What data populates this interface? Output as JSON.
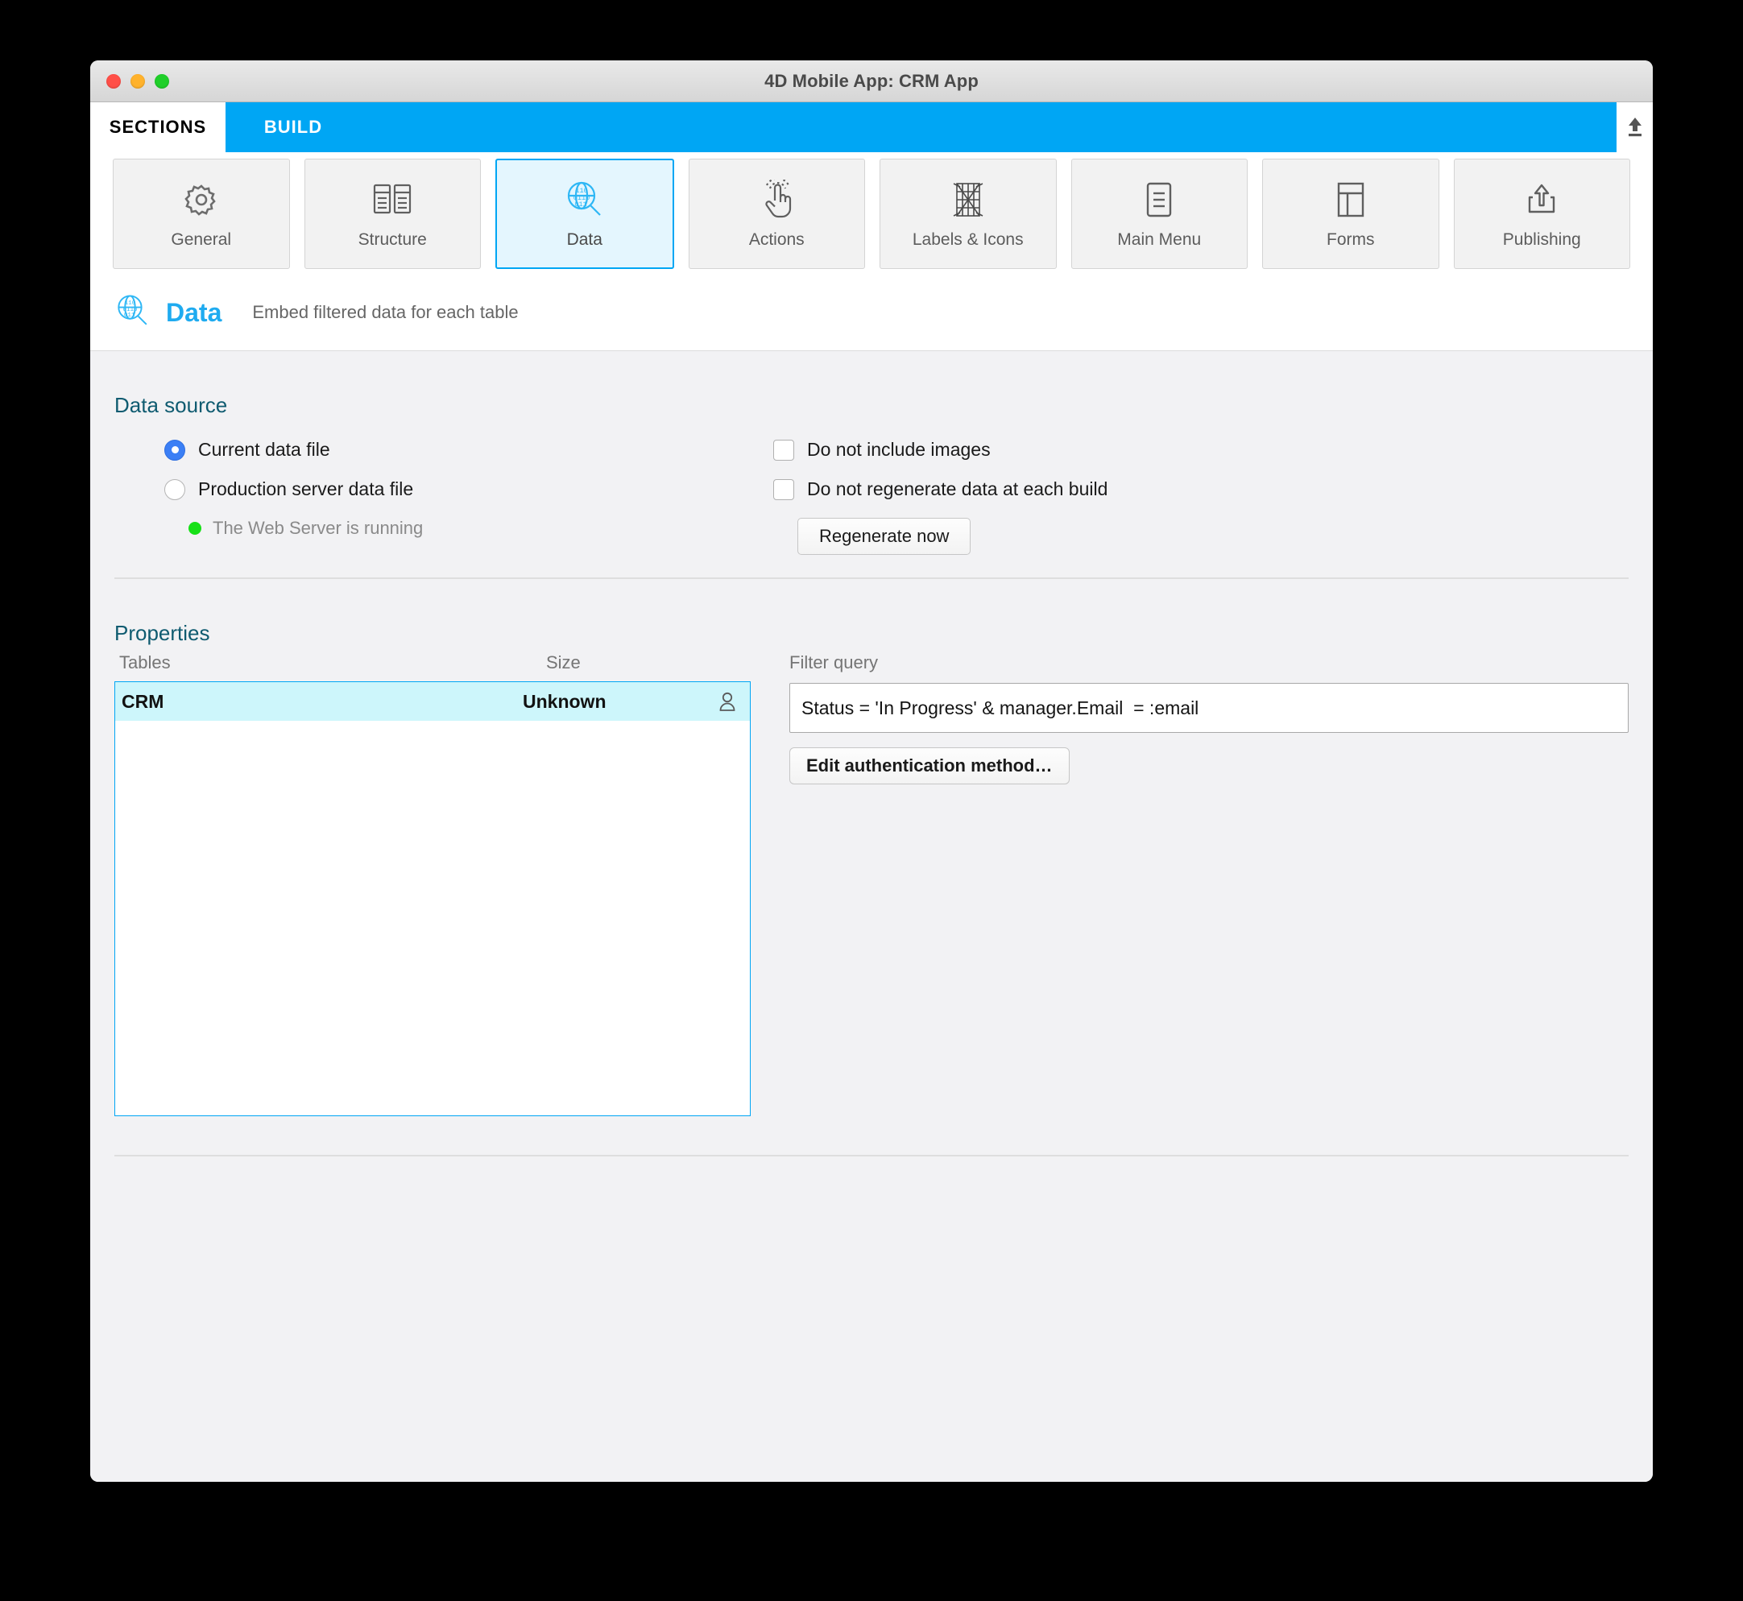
{
  "window": {
    "title": "4D Mobile App: CRM App",
    "traffic_lights": [
      "close",
      "minimize",
      "zoom"
    ]
  },
  "tabbar": {
    "tabs": [
      {
        "label": "SECTIONS",
        "active": true
      },
      {
        "label": "BUILD",
        "active": false
      }
    ],
    "export_icon": "upload-icon"
  },
  "toolbar": {
    "items": [
      {
        "label": "General",
        "icon": "gear-icon",
        "active": false
      },
      {
        "label": "Structure",
        "icon": "tables-icon",
        "active": false
      },
      {
        "label": "Data",
        "icon": "data-search-icon",
        "active": true
      },
      {
        "label": "Actions",
        "icon": "tap-hand-icon",
        "active": false
      },
      {
        "label": "Labels & Icons",
        "icon": "grid-icon",
        "active": false
      },
      {
        "label": "Main Menu",
        "icon": "menu-doc-icon",
        "active": false
      },
      {
        "label": "Forms",
        "icon": "layout-icon",
        "active": false
      },
      {
        "label": "Publishing",
        "icon": "upload-box-icon",
        "active": false
      }
    ]
  },
  "page_header": {
    "icon": "data-search-icon",
    "title": "Data",
    "subtitle": "Embed filtered data for each table"
  },
  "data_source": {
    "group_label": "Data source",
    "radios": [
      {
        "label": "Current data file",
        "selected": true
      },
      {
        "label": "Production server data file",
        "selected": false
      }
    ],
    "status": {
      "text": "The Web Server is running",
      "dot_color": "#17e017"
    },
    "checkboxes": [
      {
        "label": "Do not include images",
        "checked": false
      },
      {
        "label": "Do not regenerate data at each build",
        "checked": false
      }
    ],
    "regenerate_button": "Regenerate now"
  },
  "properties": {
    "group_label": "Properties",
    "columns": {
      "tables": "Tables",
      "size": "Size"
    },
    "rows": [
      {
        "name": "CRM",
        "size": "Unknown",
        "icon": "person-icon",
        "selected": true
      }
    ],
    "filter_query_label": "Filter query",
    "filter_query_value": "Status = 'In Progress' & manager.Email  = :email",
    "auth_button": "Edit authentication method…"
  },
  "colors": {
    "accent": "#00a6f4",
    "accent_title": "#1fabf0",
    "group_label": "#0f5b70",
    "selection_row": "#cdf6fb",
    "radio_on": "#3b7ff5",
    "status_dot": "#17e017"
  }
}
